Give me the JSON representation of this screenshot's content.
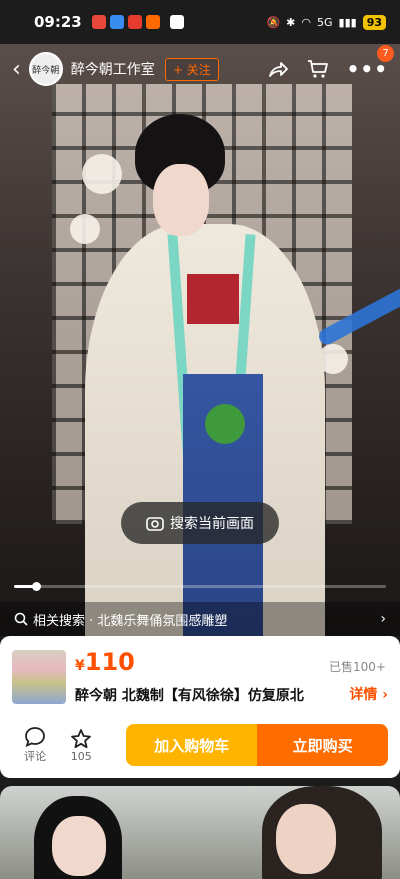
{
  "status_bar": {
    "time": "09:23",
    "battery": "93",
    "network": "5G"
  },
  "nav": {
    "shop_name": "醉今朝工作室",
    "shop_logo_text": "醉今朝",
    "follow_label": "+ 关注",
    "cart_badge": "7"
  },
  "video": {
    "search_frame_label": "搜索当前画面",
    "related_search": "相关搜索 · 北魏乐舞俑氛围感雕塑",
    "progress": 0.06
  },
  "product": {
    "currency": "¥",
    "price": "110",
    "sold": "已售100+",
    "title": "醉今朝 北魏制【有风徐徐】仿复原北",
    "detail_label": "详情 ›"
  },
  "actions": {
    "comment_label": "评论",
    "favorite_count": "105",
    "add_to_cart": "加入购物车",
    "buy_now": "立即购买"
  },
  "colors": {
    "accent": "#ff5000",
    "cart_button": "#ffb400",
    "buy_button": "#ff6c00",
    "trim": "#7cd6c4"
  }
}
